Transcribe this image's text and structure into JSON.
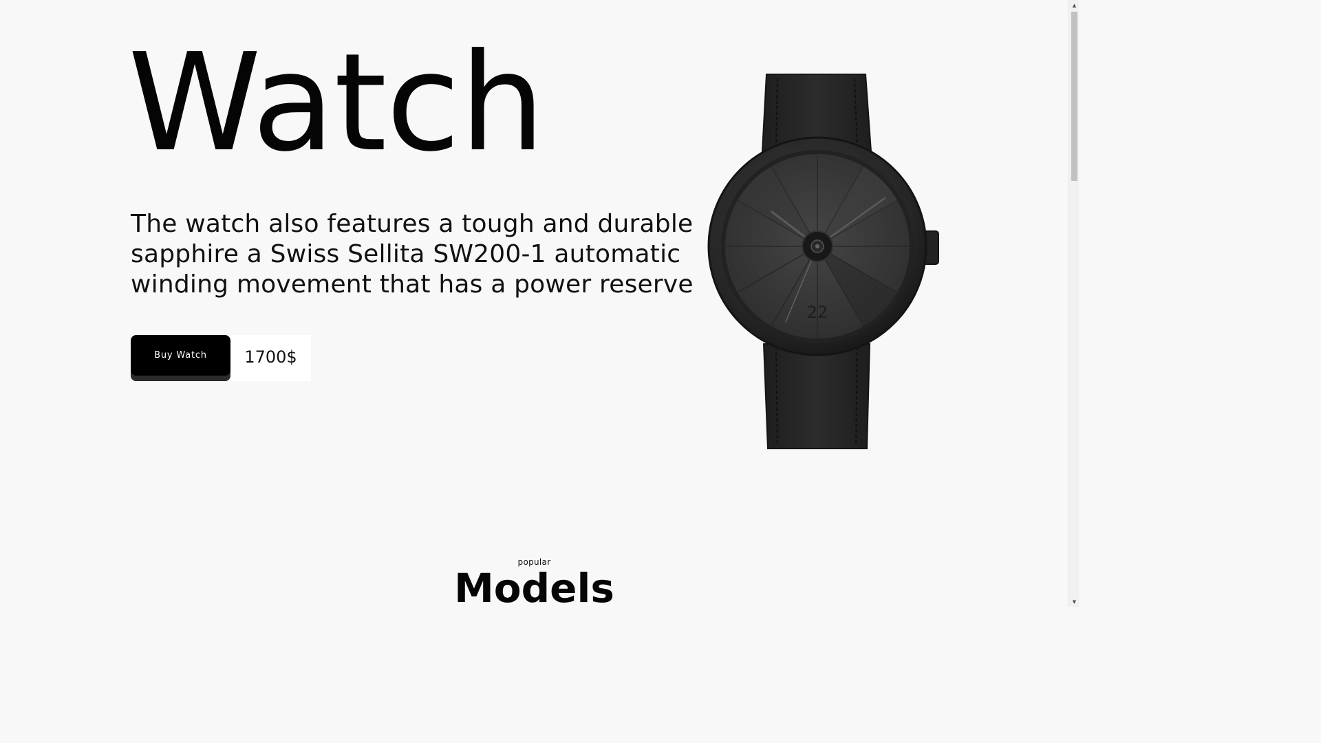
{
  "hero": {
    "title": "Watch",
    "description": "The watch also features a tough and durable sapphire a Swiss Sellita SW200-1 automatic winding movement that has a power reserve",
    "buy_label": "Buy Watch",
    "price": "1700$"
  },
  "product_image": {
    "dial_number": "22"
  },
  "section": {
    "eyebrow": "popular",
    "title": "Models"
  },
  "scrollbar": {
    "up_icon": "▲",
    "down_icon": "▼"
  },
  "colors": {
    "background": "#f8f8f8",
    "button": "#000000",
    "watch": "#2e2e2e"
  }
}
